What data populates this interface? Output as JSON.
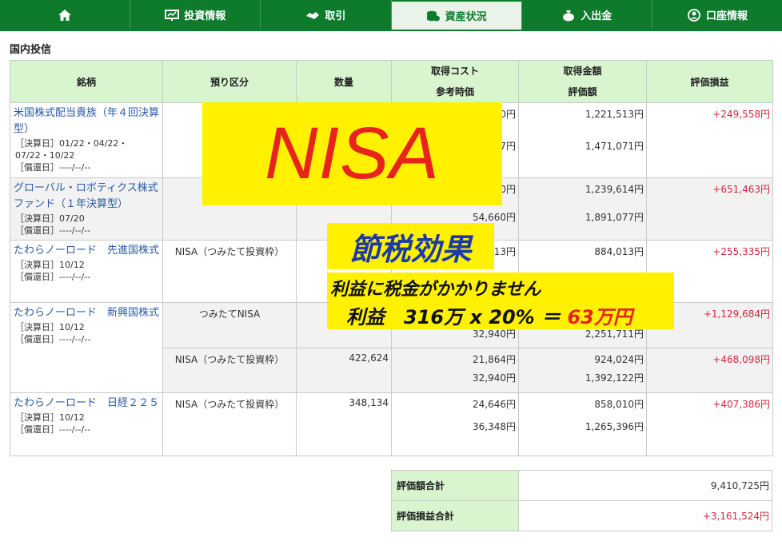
{
  "nav": {
    "home": "",
    "invest_info": "投資情報",
    "trade": "取引",
    "assets": "資産状況",
    "deposit": "入出金",
    "account": "口座情報"
  },
  "section_title": "国内投信",
  "table": {
    "headers": {
      "name": "銘柄",
      "account_type": "預り区分",
      "quantity": "数量",
      "cost_1": "取得コスト",
      "cost_2": "参考時価",
      "amount_1": "取得金額",
      "amount_2": "評価額",
      "pl": "評価損益"
    },
    "rows": [
      {
        "name": "米国株式配当貴族（年４回決算型）",
        "settle": "［決算日］01/22・04/22・07/22・10/22",
        "redeem": "［償還日］----/--/--",
        "account_type": "NISA",
        "quantity": "",
        "cost": "60円",
        "price": "97円",
        "acq_amount": "1,221,513円",
        "eval_amount": "1,471,071円",
        "pl": "+249,558円"
      },
      {
        "name": "グローバル・ロボティクス株式ファンド（１年決算型）",
        "settle": "［決算日］07/20",
        "redeem": "［償還日］----/--/--",
        "account_type": "NISA",
        "quantity": "",
        "cost": "30円",
        "price": "54,660円",
        "acq_amount": "1,239,614円",
        "eval_amount": "1,891,077円",
        "pl": "+651,463円"
      },
      {
        "name": "たわらノーロード　先進国株式",
        "settle": "［決算日］10/12",
        "redeem": "［償還日］----/--/--",
        "account_type": "NISA（つみたて投資枠）",
        "quantity": "",
        "cost": "13円",
        "price": "",
        "acq_amount": "884,013円",
        "eval_amount": "",
        "pl": "+255,335円"
      },
      {
        "name": "たわらノーロード　新興国株式",
        "settle": "［決算日］10/12",
        "redeem": "［償還日］----/--/--",
        "account_type": "つみたてNISA",
        "quantity": "",
        "cost": "",
        "price": "32,940円",
        "acq_amount": "",
        "eval_amount": "2,251,711円",
        "pl": "+1,129,684円",
        "sub": {
          "account_type": "NISA（つみたて投資枠）",
          "quantity": "422,624",
          "cost": "21,864円",
          "price": "32,940円",
          "acq_amount": "924,024円",
          "eval_amount": "1,392,122円",
          "pl": "+468,098円"
        }
      },
      {
        "name": "たわらノーロード　日経２２５",
        "settle": "［決算日］10/12",
        "redeem": "［償還日］----/--/--",
        "account_type": "NISA（つみたて投資枠）",
        "quantity": "348,134",
        "cost": "24,646円",
        "price": "36,348円",
        "acq_amount": "858,010円",
        "eval_amount": "1,265,396円",
        "pl": "+407,386円"
      }
    ]
  },
  "summary": {
    "eval_total_label": "評価額合計",
    "eval_total": "9,410,725円",
    "pl_total_label": "評価損益合計",
    "pl_total": "+3,161,524円"
  },
  "overlay": {
    "nisa": "NISA",
    "setsuzei": "節税効果",
    "line1": "利益に税金がかかりません",
    "line2_prefix": "利益　316万 x 20% ＝ ",
    "line2_highlight": "63万円"
  },
  "colors": {
    "nav_bg": "#0d7a2c",
    "header_bg": "#d8f5d0",
    "link": "#2a5aa8",
    "profit_red": "#d4253d",
    "overlay_yellow": "#fff100",
    "overlay_red": "#e8231c",
    "overlay_blue": "#1d3ba8"
  }
}
